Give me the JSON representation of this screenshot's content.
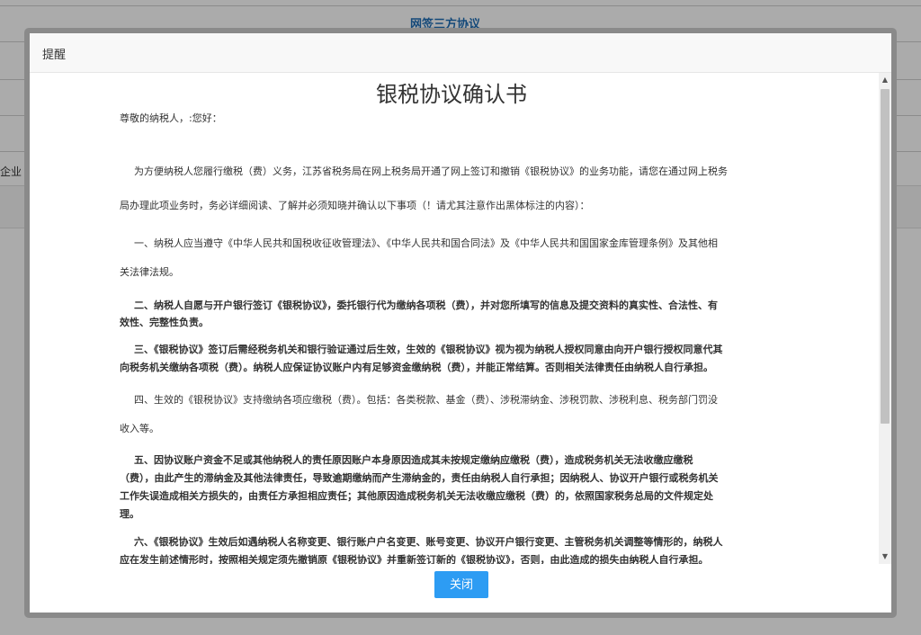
{
  "background": {
    "title": "网签三方协议",
    "left_fragment": "企业（"
  },
  "dialog": {
    "title": "提醒",
    "doc_title": "银税协议确认书",
    "greeting": "尊敬的纳税人，:您好：",
    "paragraphs": [
      {
        "lines": [
          "为方便纳税人您履行缴税（费）义务，江苏省税务局在网上税务局开通了网上签订和撤销《银税协议》的业务功能，请您在通过网上税务",
          "局办理此项业务时，务必详细阅读、了解并必须知晓并确认以下事项（！请尤其注意作出黑体标注的内容）："
        ]
      },
      {
        "lines": [
          "一、纳税人应当遵守《中华人民共和国税收征收管理法》、《中华人民共和国合同法》及《中华人民共和国国家金库管理条例》及其他相",
          "关法律法规。"
        ]
      },
      {
        "lines": [
          "二、纳税人自愿与开户银行签订《银税协议》，委托银行代为缴纳各项税（费），并对您所填写的信息及提交资料的真实性、合法性、有",
          "效性、完整性负责。"
        ]
      },
      {
        "lines": [
          "三、《银税协议》签订后需经税务机关和银行验证通过后生效，生效的《银税协议》视为视为纳税人授权同意由向开户银行授权同意代其",
          "向税务机关缴纳各项税（费）。纳税人应保证协议账户内有足够资金缴纳税（费），并能正常结算。否则相关法律责任由纳税人自行承担。"
        ]
      },
      {
        "lines": [
          "四、生效的《银税协议》支持缴纳各项应缴税（费）。包括：各类税款、基金（费）、涉税滞纳金、涉税罚款、涉税利息、税务部门罚没",
          "收入等。"
        ]
      },
      {
        "lines": [
          "五、因协议账户资金不足或其他纳税人的责任原因账户本身原因造成其未按规定缴纳应缴税（费），造成税务机关无法收缴应缴税",
          "（费），由此产生的滞纳金及其他法律责任，导致逾期缴纳而产生滞纳金的，责任由纳税人自行承担；因纳税人、协议开户银行或税务机关",
          "工作失误造成相关方损失的，由责任方承担相应责任；其他原因造成税务机关无法收缴应缴税（费）的，依照国家税务总局的文件规定处",
          "理。"
        ]
      },
      {
        "lines": [
          "六、《银税协议》生效后如遇纳税人名称变更、银行账户户名变更、账号变更、协议开户银行变更、主管税务机关调整等情形的，纳税人",
          "应在发生前述情形时，按照相关规定须先撤销原《银税协议》并重新签订新的《银税协议》，否则，由此造成的损失由纳税人自行承担。"
        ]
      }
    ],
    "close_label": "关闭"
  },
  "icons": {
    "scroll_up": "scroll-up-arrow-icon",
    "scroll_down": "scroll-down-arrow-icon"
  },
  "colors": {
    "accent": "#2d9cf3",
    "bg_title": "#1f6db5"
  }
}
